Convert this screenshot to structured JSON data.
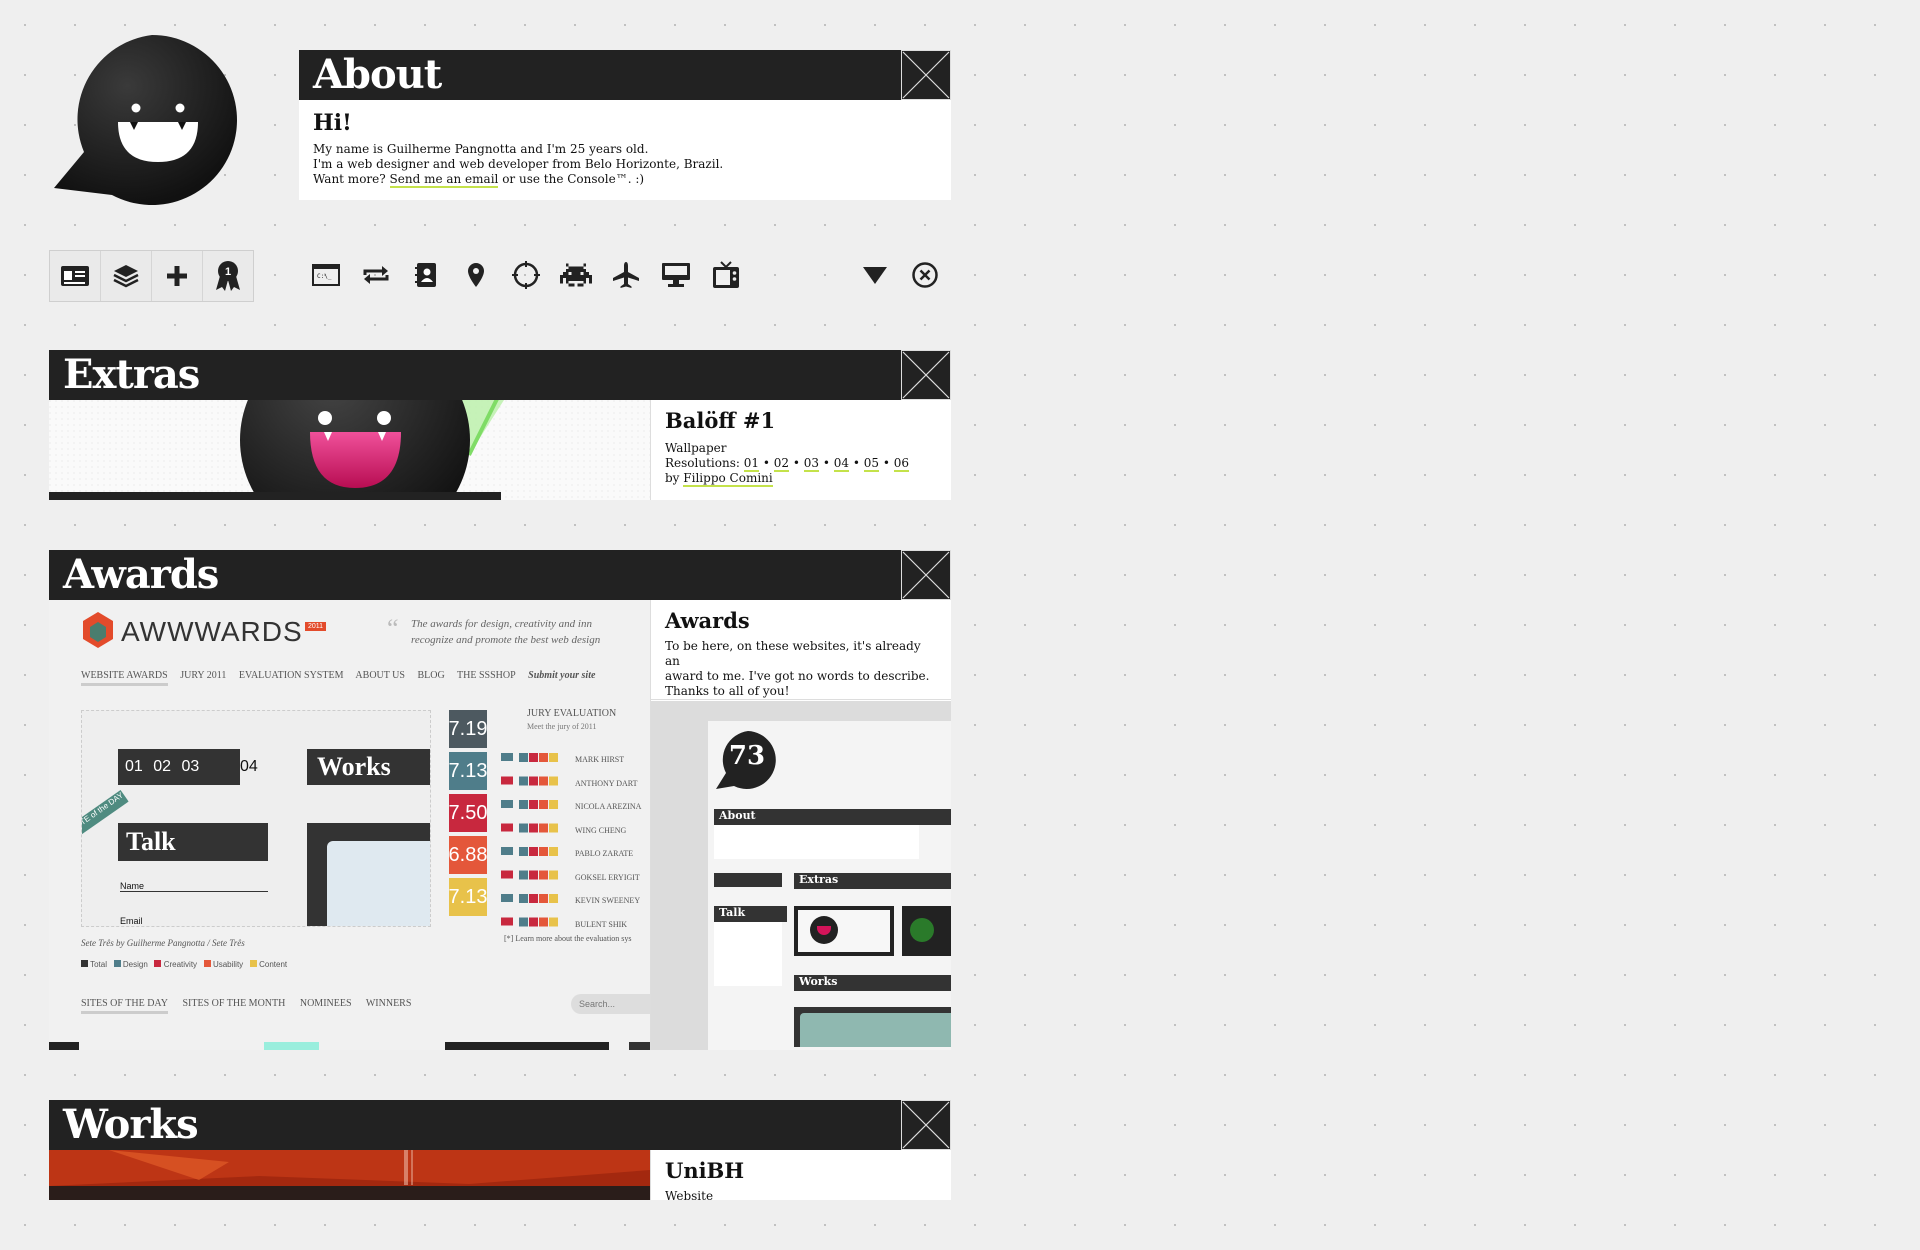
{
  "about": {
    "title": "About",
    "greeting": "Hi!",
    "line1": "My name is Guilherme Pangnotta and I'm 25 years old.",
    "line2": "I'm a web designer and web developer from Belo Horizonte, Brazil.",
    "line3_pre": "Want more?",
    "line3_link": "Send me an email",
    "line3_post": "or use the Console™.   :)"
  },
  "toolbar_left": [
    {
      "icon": "id-card-icon"
    },
    {
      "icon": "layers-icon"
    },
    {
      "icon": "plus-icon"
    },
    {
      "icon": "award-badge-icon",
      "badge": "1"
    }
  ],
  "toolbar_right": [
    {
      "icon": "console-icon"
    },
    {
      "icon": "repeat-icon"
    },
    {
      "icon": "contact-book-icon"
    },
    {
      "icon": "location-pin-icon"
    },
    {
      "icon": "target-icon"
    },
    {
      "icon": "space-invader-icon"
    },
    {
      "icon": "airplane-icon"
    },
    {
      "icon": "monitor-icon"
    },
    {
      "icon": "tv-icon"
    }
  ],
  "extras": {
    "title": "Extras",
    "item_title": "Balöff #1",
    "type": "Wallpaper",
    "resolutions_label": "Resolutions:",
    "resolutions": [
      "01",
      "02",
      "03",
      "04",
      "05",
      "06"
    ],
    "by_label": "by",
    "author": "Filippo Comini"
  },
  "awards": {
    "title": "Awards",
    "heading": "Awards",
    "line1": "To be here, on these websites, it's already an",
    "line2": "award to me. I've got no words to describe.",
    "line3": "Thanks to all of you!",
    "screenshot": {
      "brand": "AWWWARDS",
      "brand_year": "2011",
      "quote1": "The awards for design, creativity and inn",
      "quote2": "recognize and promote the best web design",
      "nav": [
        "WEBSITE AWARDS",
        "JURY 2011",
        "EVALUATION SYSTEM",
        "ABOUT US",
        "BLOG",
        "THE SSSHOP",
        "Submit your site"
      ],
      "jury_title": "JURY EVALUATION",
      "jury_sub": "Meet the jury of 2011",
      "scores": [
        "7.19",
        "7.13",
        "7.50",
        "6.88",
        "7.13"
      ],
      "jurors": [
        "MARK HIRST",
        "ANTHONY DART",
        "NICOLA AREZINA",
        "WING CHENG",
        "PABLO ZARATE",
        "GOKSEL ERYIGIT",
        "KEVIN SWEENEY",
        "BULENT SHIK"
      ],
      "digits": [
        "01",
        "02",
        "03",
        "04"
      ],
      "works_label": "Works",
      "talk_label": "Talk",
      "name_label": "Name",
      "email_label": "Email",
      "ribbon": "SITE of the DAY",
      "credit": "Sete Três by Guilherme Pangnotta / Sete Três",
      "legend": [
        "Total",
        "Design",
        "Creativity",
        "Usability",
        "Content"
      ],
      "learn_more": "[*] Learn more about the evaluation sys",
      "bottom_nav": [
        "SITES OF THE DAY",
        "SITES OF THE MONTH",
        "NOMINEES",
        "WINNERS"
      ],
      "search": "Search...",
      "thumb_number": "73",
      "thumb_about": "About",
      "thumb_extras": "Extras",
      "thumb_talk": "Talk",
      "thumb_works": "Works"
    }
  },
  "works": {
    "title": "Works",
    "item_title": "UniBH",
    "type": "Website"
  },
  "colors": {
    "bar": "#222222",
    "link_underline": "#c4e24a",
    "pink": "#d4145a"
  }
}
